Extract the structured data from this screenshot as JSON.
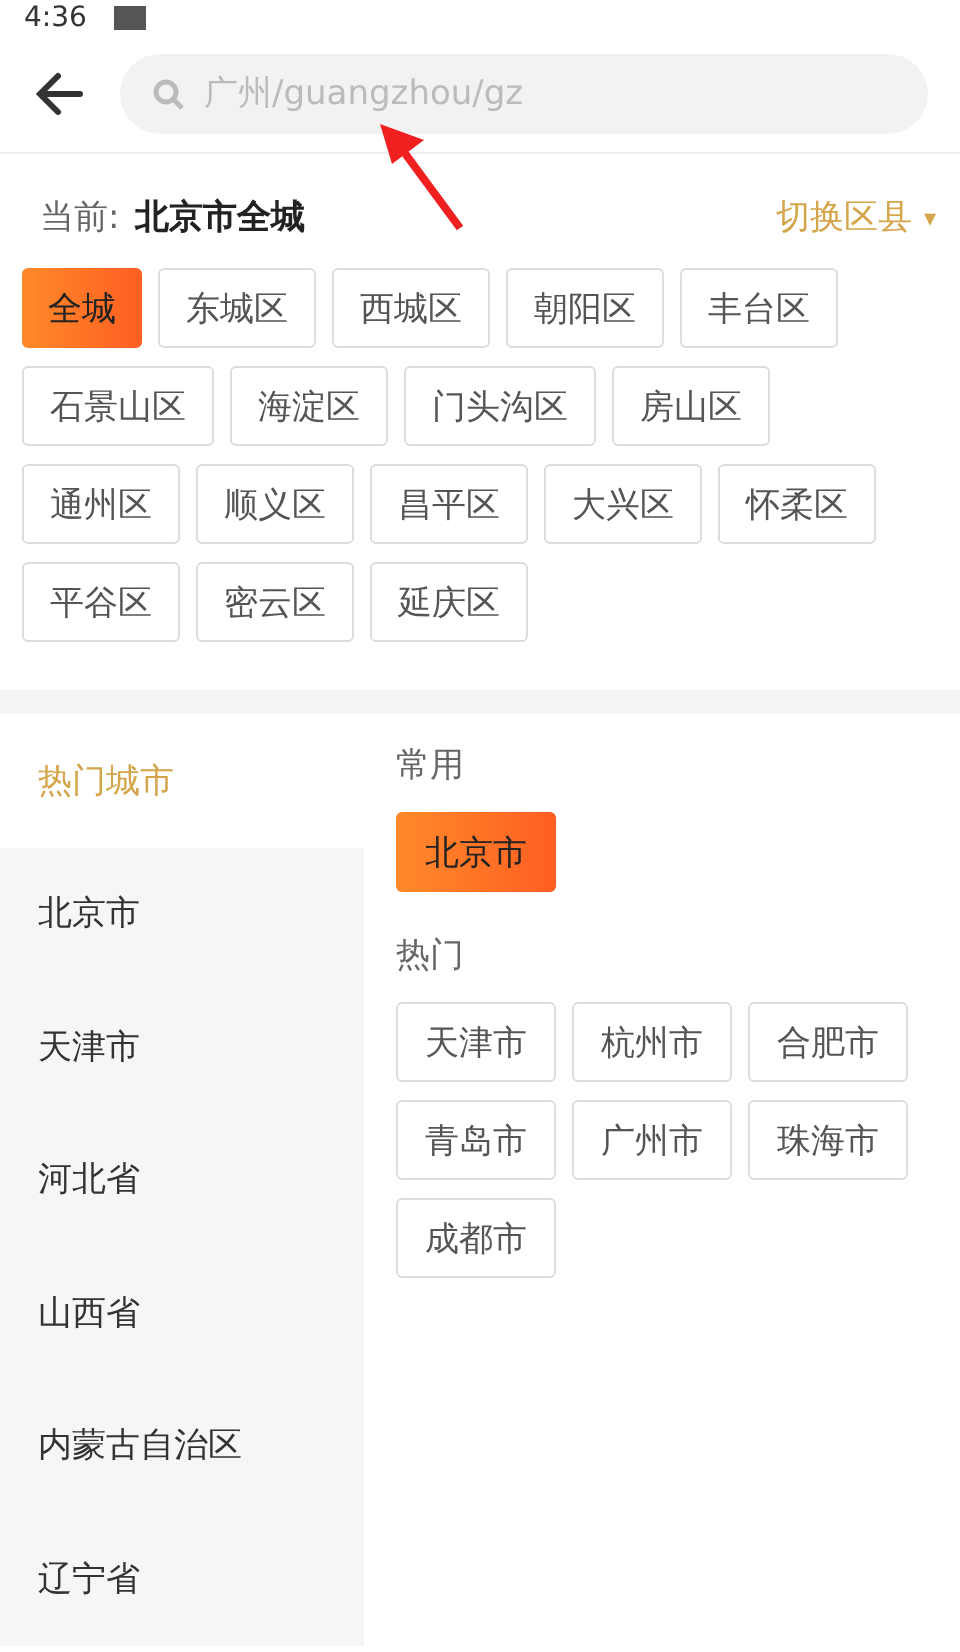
{
  "status_bar": {
    "time": "4:36"
  },
  "search": {
    "placeholder": "广州/guangzhou/gz"
  },
  "current": {
    "label": "当前:",
    "value": "北京市全城",
    "switch": "切换区县",
    "switch_icon": "▾"
  },
  "districts": [
    {
      "label": "全城",
      "selected": true
    },
    {
      "label": "东城区",
      "selected": false
    },
    {
      "label": "西城区",
      "selected": false
    },
    {
      "label": "朝阳区",
      "selected": false
    },
    {
      "label": "丰台区",
      "selected": false
    },
    {
      "label": "石景山区",
      "selected": false
    },
    {
      "label": "海淀区",
      "selected": false
    },
    {
      "label": "门头沟区",
      "selected": false
    },
    {
      "label": "房山区",
      "selected": false
    },
    {
      "label": "通州区",
      "selected": false
    },
    {
      "label": "顺义区",
      "selected": false
    },
    {
      "label": "昌平区",
      "selected": false
    },
    {
      "label": "大兴区",
      "selected": false
    },
    {
      "label": "怀柔区",
      "selected": false
    },
    {
      "label": "平谷区",
      "selected": false
    },
    {
      "label": "密云区",
      "selected": false
    },
    {
      "label": "延庆区",
      "selected": false
    }
  ],
  "sidebar": {
    "items": [
      {
        "label": "热门城市",
        "selected": true
      },
      {
        "label": "北京市",
        "selected": false
      },
      {
        "label": "天津市",
        "selected": false
      },
      {
        "label": "河北省",
        "selected": false
      },
      {
        "label": "山西省",
        "selected": false
      },
      {
        "label": "内蒙古自治区",
        "selected": false
      },
      {
        "label": "辽宁省",
        "selected": false
      }
    ]
  },
  "sections": [
    {
      "title": "常用",
      "cities": [
        {
          "label": "北京市",
          "selected": true
        }
      ]
    },
    {
      "title": "热门",
      "cities": [
        {
          "label": "天津市",
          "selected": false
        },
        {
          "label": "杭州市",
          "selected": false
        },
        {
          "label": "合肥市",
          "selected": false
        },
        {
          "label": "青岛市",
          "selected": false
        },
        {
          "label": "广州市",
          "selected": false
        },
        {
          "label": "珠海市",
          "selected": false
        },
        {
          "label": "成都市",
          "selected": false
        }
      ]
    }
  ]
}
